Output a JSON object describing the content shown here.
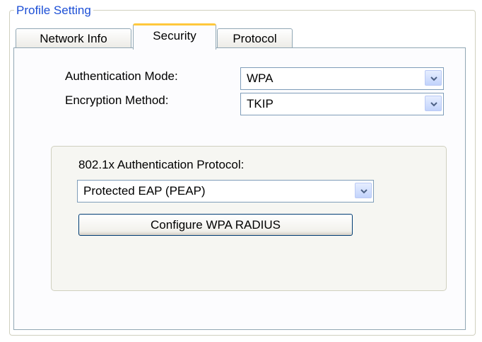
{
  "profile_group": {
    "legend": "Profile Setting"
  },
  "tabs": [
    {
      "label": "Network Info",
      "active": false
    },
    {
      "label": "Security",
      "active": true
    },
    {
      "label": "Protocol",
      "active": false
    }
  ],
  "security": {
    "auth_mode_label": "Authentication Mode:",
    "auth_mode_value": "WPA",
    "encryption_label": "Encryption Method:",
    "encryption_value": "TKIP",
    "protocol_group": {
      "label": "802.1x Authentication Protocol:",
      "protocol_value": "Protected EAP (PEAP)",
      "configure_button": "Configure WPA RADIUS"
    }
  },
  "icons": {
    "dropdown": "chevron-down-icon"
  },
  "colors": {
    "legend_text": "#1c4fd6",
    "active_tab_accent": "#ffc83c",
    "dropdown_arrow": "#4d6185",
    "button_border": "#003c74"
  }
}
